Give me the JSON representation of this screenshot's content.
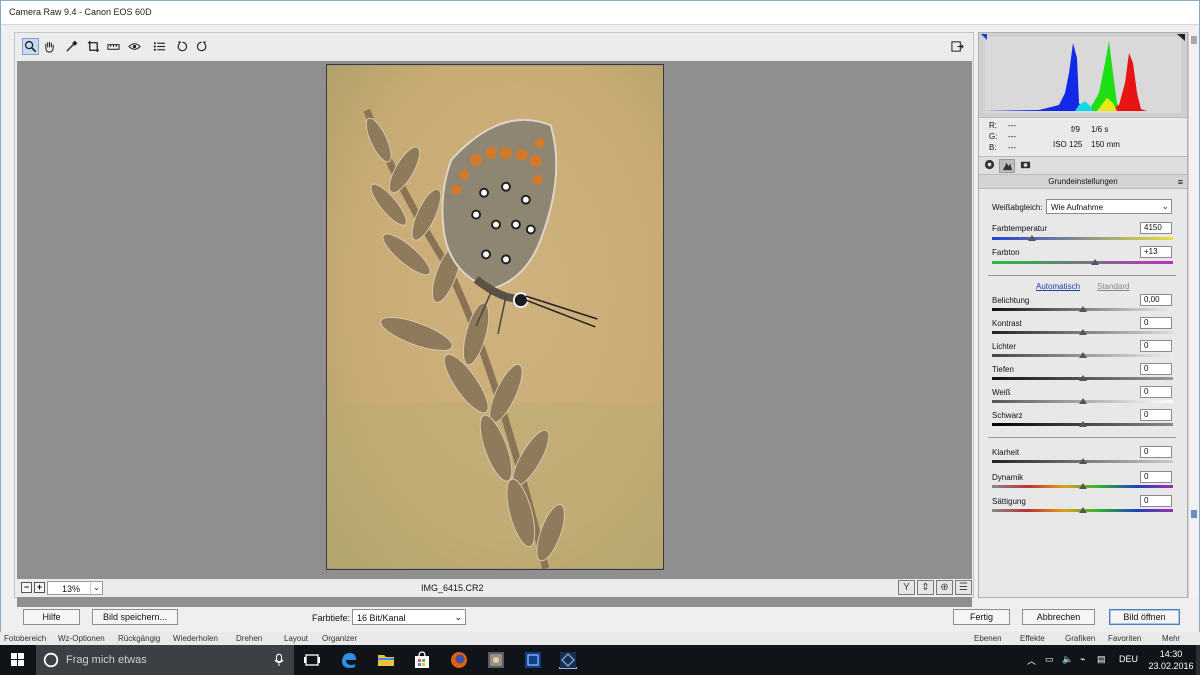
{
  "window": {
    "title": "Camera Raw 9.4 -  Canon EOS 60D"
  },
  "toolbar": {
    "tools": [
      "zoom-tool",
      "hand-tool",
      "white-balance-tool",
      "crop-tool",
      "straighten-tool",
      "red-eye-tool",
      "preferences",
      "rotate-left",
      "rotate-right"
    ],
    "selected_tool": "zoom-tool"
  },
  "preview": {
    "zoom_value": "13%",
    "filename": "IMG_6415.CR2"
  },
  "info": {
    "r_label": "R:",
    "r_value": "---",
    "g_label": "G:",
    "g_value": "---",
    "b_label": "B:",
    "b_value": "---",
    "aperture": "f/9",
    "shutter": "1/6 s",
    "iso": "ISO 125",
    "focal": "150 mm"
  },
  "panel": {
    "header": "Grundeinstellungen",
    "wb_label": "Weißabgleich:",
    "wb_value": "Wie Aufnahme",
    "temp_label": "Farbtemperatur",
    "temp_value": "4150",
    "tint_label": "Farbton",
    "tint_value": "+13",
    "auto_link": "Automatisch",
    "default_link": "Standard",
    "exposure_label": "Belichtung",
    "exposure_value": "0,00",
    "contrast_label": "Kontrast",
    "contrast_value": "0",
    "highlights_label": "Lichter",
    "highlights_value": "0",
    "shadows_label": "Tiefen",
    "shadows_value": "0",
    "whites_label": "Weiß",
    "whites_value": "0",
    "blacks_label": "Schwarz",
    "blacks_value": "0",
    "clarity_label": "Klarheit",
    "clarity_value": "0",
    "vibrance_label": "Dynamik",
    "vibrance_value": "0",
    "saturation_label": "Sättigung",
    "saturation_value": "0",
    "slider_levels": {
      "temp": 0.22,
      "tint": 0.57,
      "exposure": 0.5,
      "contrast": 0.5,
      "highlights": 0.5,
      "shadows": 0.5,
      "whites": 0.5,
      "blacks": 0.5,
      "clarity": 0.5,
      "vibrance": 0.5,
      "saturation": 0.5
    }
  },
  "footer": {
    "help": "Hilfe",
    "save_image": "Bild speichern...",
    "depth_label": "Farbtiefe:",
    "depth_value": "16 Bit/Kanal",
    "done": "Fertig",
    "cancel": "Abbrechen",
    "open_image": "Bild öffnen"
  },
  "background_app_menu": [
    "Fotobereich",
    "Wz-Optionen",
    "Rückgängig",
    "Wiederholen",
    "Drehen",
    "Layout",
    "Organizer",
    "Ebenen",
    "Effekte",
    "Grafiken",
    "Favoriten",
    "Mehr"
  ],
  "taskbar": {
    "search_placeholder": "Frag mich etwas",
    "language": "DEU",
    "time": "14:30",
    "date": "23.02.2016"
  },
  "colors": {
    "taskbar_bg": "#101418",
    "accent": "#4d7fc2",
    "preview_bg": "#8f8f8f"
  }
}
